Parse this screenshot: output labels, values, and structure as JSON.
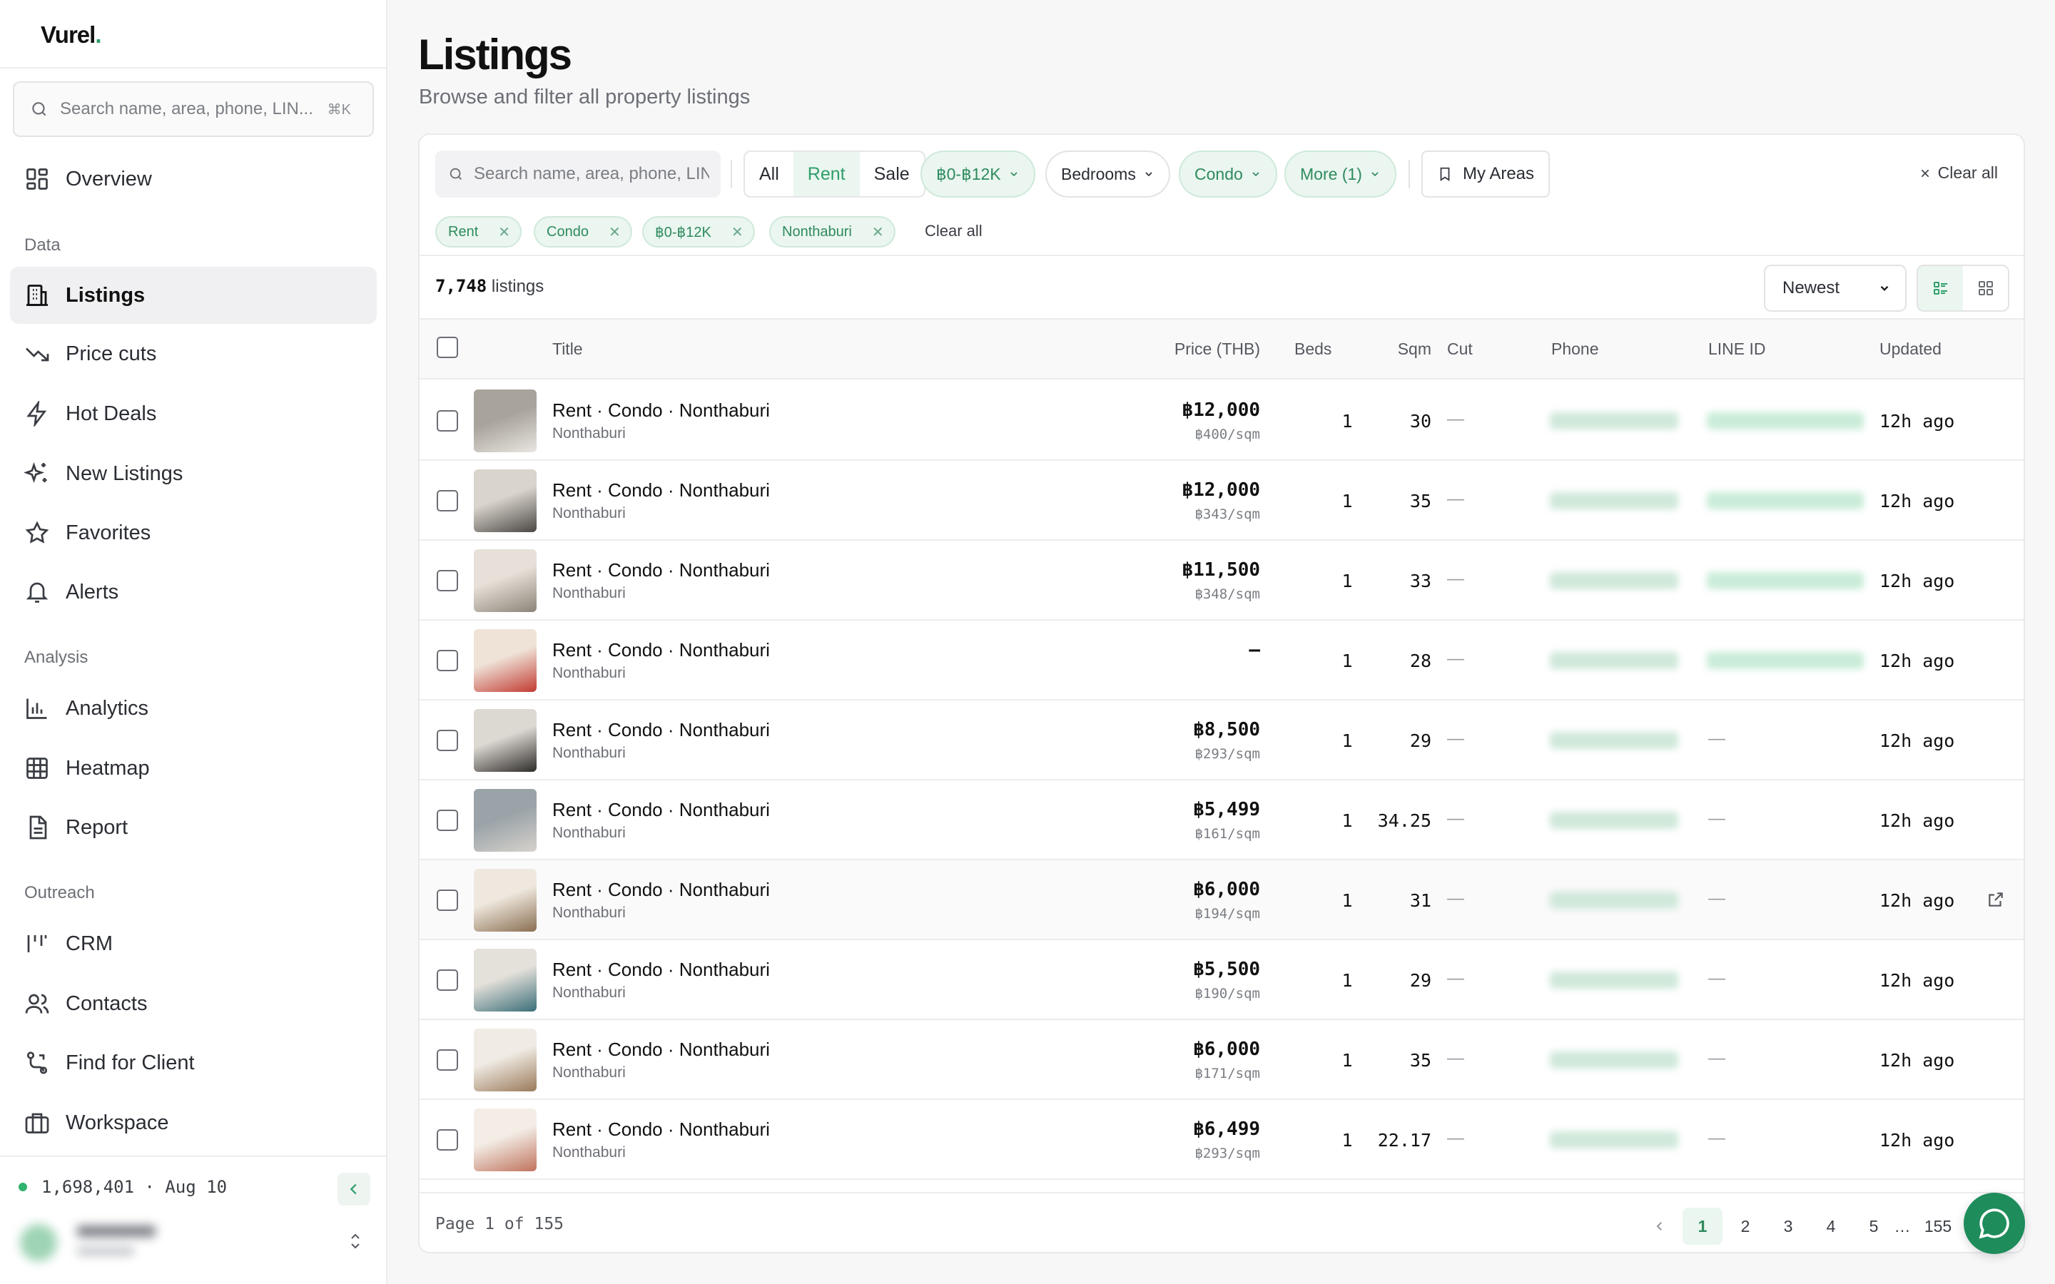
{
  "sidebar": {
    "brand": "Vurel",
    "brand_dot": ".",
    "search_placeholder": "Search name, area, phone, LIN...",
    "search_kbd": "⌘K",
    "overview": "Overview",
    "sections": {
      "data": "Data",
      "analysis": "Analysis",
      "outreach": "Outreach"
    },
    "items": {
      "listings": "Listings",
      "price_cuts": "Price cuts",
      "hot_deals": "Hot Deals",
      "new_listings": "New Listings",
      "favorites": "Favorites",
      "alerts": "Alerts",
      "analytics": "Analytics",
      "heatmap": "Heatmap",
      "report": "Report",
      "crm": "CRM",
      "contacts": "Contacts",
      "find_for_client": "Find for Client",
      "workspace": "Workspace"
    },
    "status_text": "1,698,401 · Aug 10"
  },
  "header": {
    "title": "Listings",
    "subtitle": "Browse and filter all property listings"
  },
  "filters": {
    "search_placeholder": "Search name, area, phone, LINE ID",
    "type_tabs": [
      "All",
      "Rent",
      "Sale"
    ],
    "active_type": "Rent",
    "price": "฿0-฿12K",
    "bedrooms": "Bedrooms",
    "property_type": "Condo",
    "more": "More (1)",
    "my_areas": "My Areas",
    "clear_all": "Clear all",
    "chips": [
      "Rent",
      "Condo",
      "฿0-฿12K",
      "Nonthaburi"
    ],
    "chips_clear": "Clear all"
  },
  "results": {
    "count": "7,748",
    "count_label": "listings",
    "sort": "Newest"
  },
  "table": {
    "headers": {
      "title": "Title",
      "price": "Price (THB)",
      "beds": "Beds",
      "sqm": "Sqm",
      "cut": "Cut",
      "phone": "Phone",
      "line_id": "LINE ID",
      "updated": "Updated"
    },
    "rows": [
      {
        "title": "Rent · Condo · Nonthaburi",
        "area": "Nonthaburi",
        "price": "฿12,000",
        "per_sqm": "฿400/sqm",
        "beds": "1",
        "sqm": "30",
        "cut": "—",
        "line_id_shown": true,
        "updated": "12h ago"
      },
      {
        "title": "Rent · Condo · Nonthaburi",
        "area": "Nonthaburi",
        "price": "฿12,000",
        "per_sqm": "฿343/sqm",
        "beds": "1",
        "sqm": "35",
        "cut": "—",
        "line_id_shown": true,
        "updated": "12h ago"
      },
      {
        "title": "Rent · Condo · Nonthaburi",
        "area": "Nonthaburi",
        "price": "฿11,500",
        "per_sqm": "฿348/sqm",
        "beds": "1",
        "sqm": "33",
        "cut": "—",
        "line_id_shown": true,
        "updated": "12h ago"
      },
      {
        "title": "Rent · Condo · Nonthaburi",
        "area": "Nonthaburi",
        "price": "–",
        "per_sqm": "",
        "beds": "1",
        "sqm": "28",
        "cut": "—",
        "line_id_shown": true,
        "updated": "12h ago"
      },
      {
        "title": "Rent · Condo · Nonthaburi",
        "area": "Nonthaburi",
        "price": "฿8,500",
        "per_sqm": "฿293/sqm",
        "beds": "1",
        "sqm": "29",
        "cut": "—",
        "line_id_shown": false,
        "updated": "12h ago"
      },
      {
        "title": "Rent · Condo · Nonthaburi",
        "area": "Nonthaburi",
        "price": "฿5,499",
        "per_sqm": "฿161/sqm",
        "beds": "1",
        "sqm": "34.25",
        "cut": "—",
        "line_id_shown": false,
        "updated": "12h ago"
      },
      {
        "title": "Rent · Condo · Nonthaburi",
        "area": "Nonthaburi",
        "price": "฿6,000",
        "per_sqm": "฿194/sqm",
        "beds": "1",
        "sqm": "31",
        "cut": "—",
        "line_id_shown": false,
        "updated": "12h ago"
      },
      {
        "title": "Rent · Condo · Nonthaburi",
        "area": "Nonthaburi",
        "price": "฿5,500",
        "per_sqm": "฿190/sqm",
        "beds": "1",
        "sqm": "29",
        "cut": "—",
        "line_id_shown": false,
        "updated": "12h ago"
      },
      {
        "title": "Rent · Condo · Nonthaburi",
        "area": "Nonthaburi",
        "price": "฿6,000",
        "per_sqm": "฿171/sqm",
        "beds": "1",
        "sqm": "35",
        "cut": "—",
        "line_id_shown": false,
        "updated": "12h ago"
      },
      {
        "title": "Rent · Condo · Nonthaburi",
        "area": "Nonthaburi",
        "price": "฿6,499",
        "per_sqm": "฿293/sqm",
        "beds": "1",
        "sqm": "22.17",
        "cut": "—",
        "line_id_shown": false,
        "updated": "12h ago"
      }
    ],
    "line_id_empty": "—"
  },
  "pagination": {
    "label": "Page 1 of 155",
    "pages": [
      "1",
      "2",
      "3",
      "4",
      "5"
    ],
    "ellipsis": "…",
    "last": "155",
    "current": "1"
  },
  "colors": {
    "accent": "#2f9e6a",
    "accent_bg": "#eaf6ef",
    "fab": "#1e8c5b"
  },
  "icons": [
    "search-icon",
    "overview-icon",
    "building-icon",
    "trend-down-icon",
    "bolt-icon",
    "sparkle-icon",
    "star-icon",
    "bell-icon",
    "bar-chart-icon",
    "grid-icon",
    "document-icon",
    "crm-icon",
    "users-icon",
    "route-icon",
    "briefcase-icon",
    "chevron-left-icon",
    "chevron-updown-icon",
    "chevron-down-icon",
    "bookmark-icon",
    "close-icon",
    "list-view-icon",
    "grid-view-icon",
    "external-link-icon",
    "chat-icon"
  ]
}
